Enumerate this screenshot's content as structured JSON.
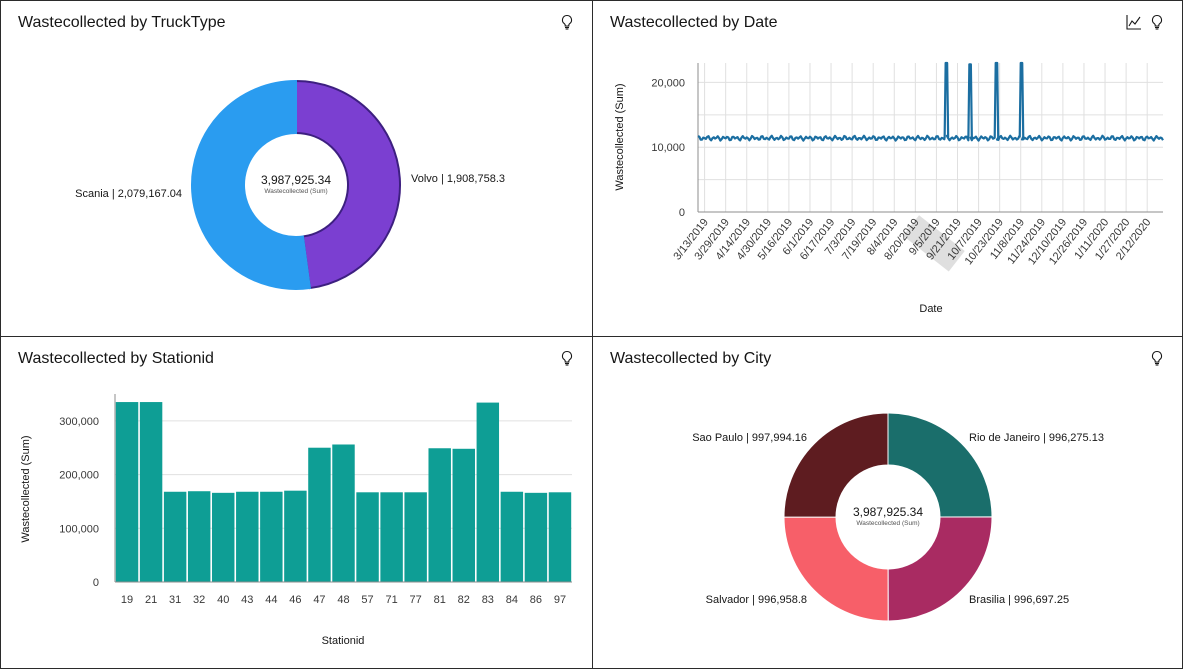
{
  "colors": {
    "scania": "#2a9cf0",
    "volvo": "#7b3fd1",
    "line": "#1b6ea1",
    "bars": "#0e9e95",
    "rio": "#1a6e6b",
    "brasilia": "#a92b62",
    "salvador": "#f75f69",
    "saopaulo": "#5e1c20"
  },
  "icons": [
    "lightbulb-icon",
    "line-chart-icon"
  ],
  "panels": [
    {
      "title": "Wastecollected by TruckType",
      "chart_data": {
        "type": "pie",
        "donut": true,
        "center_value": "3,987,925.34",
        "center_label": "Wastecollected (Sum)",
        "slices": [
          {
            "name": "Volvo",
            "value": 1908758.3,
            "label": "Volvo | 1,908,758.3"
          },
          {
            "name": "Scania",
            "value": 2079167.04,
            "label": "Scania | 2,079,167.04"
          }
        ]
      }
    },
    {
      "title": "Wastecollected by Date",
      "chart_data": {
        "type": "line",
        "xlabel": "Date",
        "ylabel": "Wastecollected (Sum)",
        "ylim": [
          0,
          23000
        ],
        "yticks": [
          0,
          10000,
          20000
        ],
        "ytick_labels": [
          "0",
          "10,000",
          "20,000"
        ],
        "xticks": [
          "3/13/2019",
          "3/29/2019",
          "4/14/2019",
          "4/30/2019",
          "5/16/2019",
          "6/1/2019",
          "6/17/2019",
          "7/3/2019",
          "7/19/2019",
          "8/4/2019",
          "8/20/2019",
          "9/5/2019",
          "9/21/2019",
          "10/7/2019",
          "10/23/2019",
          "11/8/2019",
          "11/24/2019",
          "12/10/2019",
          "12/26/2019",
          "1/11/2020",
          "1/27/2020",
          "2/12/2020"
        ],
        "highlighted_tick": "8/20/2019",
        "x_range": [
          "3/8/2019",
          "2/24/2020"
        ],
        "baseline": 11400,
        "spikes": [
          {
            "date": "9/12/2019",
            "value": 23000
          },
          {
            "date": "9/30/2019",
            "value": 22800
          },
          {
            "date": "10/20/2019",
            "value": 23000
          },
          {
            "date": "11/8/2019",
            "value": 23000
          }
        ]
      }
    },
    {
      "title": "Wastecollected by Stationid",
      "chart_data": {
        "type": "bar",
        "xlabel": "Stationid",
        "ylabel": "Wastecollected (Sum)",
        "ylim": [
          0,
          350000
        ],
        "yticks": [
          0,
          100000,
          200000,
          300000
        ],
        "ytick_labels": [
          "0",
          "100,000",
          "200,000",
          "300,000"
        ],
        "categories": [
          "19",
          "21",
          "31",
          "32",
          "40",
          "43",
          "44",
          "46",
          "47",
          "48",
          "57",
          "71",
          "77",
          "81",
          "82",
          "83",
          "84",
          "86",
          "97"
        ],
        "values": [
          335000,
          335000,
          168000,
          169000,
          166000,
          168000,
          168000,
          170000,
          250000,
          256000,
          167000,
          167000,
          167000,
          249000,
          248000,
          334000,
          168000,
          166000,
          167000
        ]
      }
    },
    {
      "title": "Wastecollected by City",
      "chart_data": {
        "type": "pie",
        "donut": true,
        "center_value": "3,987,925.34",
        "center_label": "Wastecollected (Sum)",
        "slices": [
          {
            "name": "Rio de Janeiro",
            "value": 996275.13,
            "label": "Rio de Janeiro | 996,275.13"
          },
          {
            "name": "Brasilia",
            "value": 996697.25,
            "label": "Brasilia | 996,697.25"
          },
          {
            "name": "Salvador",
            "value": 996958.8,
            "label": "Salvador | 996,958.8"
          },
          {
            "name": "Sao Paulo",
            "value": 997994.16,
            "label": "Sao Paulo | 997,994.16"
          }
        ]
      }
    }
  ]
}
